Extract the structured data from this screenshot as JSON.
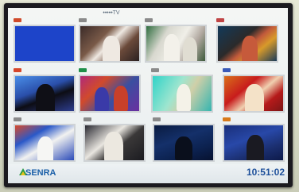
{
  "header": {
    "title": "•••••TV"
  },
  "channels": [
    {
      "label": ""
    },
    {
      "label": ""
    },
    {
      "label": ""
    },
    {
      "label": ""
    },
    {
      "label": ""
    },
    {
      "label": ""
    },
    {
      "label": ""
    },
    {
      "label": ""
    },
    {
      "label": ""
    },
    {
      "label": ""
    },
    {
      "label": ""
    },
    {
      "label": ""
    }
  ],
  "footer": {
    "logo_text": "SENRA",
    "clock": "10:51:02"
  },
  "colors": {
    "screen_bg": "#f0f3f3",
    "accent": "#1d4f9a",
    "bezel": "#1b1a1f"
  },
  "icons": {
    "logo": "senra-logo-icon"
  }
}
